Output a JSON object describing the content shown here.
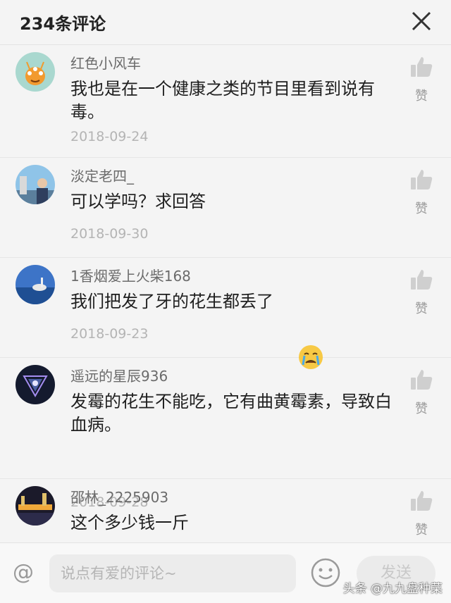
{
  "header": {
    "title": "234条评论"
  },
  "comments": [
    {
      "username": "红色小风车",
      "content": "我也是在一个健康之类的节目里看到说有毒。",
      "date": "2018-09-24",
      "like_label": "赞"
    },
    {
      "username": "淡定老四_",
      "content": "可以学吗？求回答",
      "date": "2018-09-30",
      "like_label": "赞"
    },
    {
      "username": "1香烟爱上火柴168",
      "content": "我们把发了牙的花生都丢了",
      "date": "2018-09-23",
      "like_label": "赞"
    },
    {
      "username": "遥远的星辰936",
      "content": "发霉的花生不能吃，它有曲黄霉素，导致白血病。",
      "date": "2018-09-28",
      "like_label": "赞"
    },
    {
      "username": "邵林_2225903",
      "content": "这个多少钱一斤",
      "date": "",
      "like_label": "赞"
    }
  ],
  "footer": {
    "at_symbol": "@",
    "input_placeholder": "说点有爱的评论~",
    "send_label": "发送",
    "watermark": "头条 @九九盘种菜"
  },
  "colors": {
    "background": "#f4f4f4",
    "text": "#1e1e1e",
    "muted": "#b4b4b4"
  }
}
